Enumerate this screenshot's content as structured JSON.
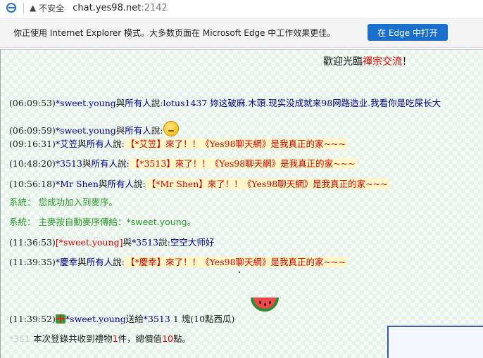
{
  "browser": {
    "security_label": "不安全",
    "url_host": "chat.yes98.net",
    "url_port": ":2142"
  },
  "ie_bar": {
    "message": "你正使用 Internet Explorer 模式。大多数页面在 Microsoft Edge 中工作效果更佳。",
    "button": "在 Edge 中打开"
  },
  "welcome": {
    "prefix": "歡迎光臨",
    "room": "禪宗交流",
    "suffix": "！"
  },
  "messages": [
    {
      "time": "(06:09:53)",
      "from": "*sweet.young",
      "mid": "與",
      "to": "所有人",
      "said": "說:",
      "text": "lotus1437 妳这破麻.木頭.现实没成就来98网路造业.我看你是吃屎长大"
    },
    {
      "time": "(06:09:59)",
      "from": "*sweet.young",
      "mid": "與",
      "to": "所有人",
      "said": "說:",
      "text": ""
    },
    {
      "time": "(09:16:31)",
      "from": "*艾笠",
      "mid": "與",
      "to": "所有人",
      "said": "說:",
      "text": "【*艾笠】來了！！《Yes98聊天網》是我真正的家~~~"
    },
    {
      "time": "(10:48:20)",
      "from": "*3513",
      "mid": "與",
      "to": "所有人",
      "said": "說:",
      "text": "【*3513】來了！！《Yes98聊天網》是我真正的家~~~"
    },
    {
      "time": "(10:56:18)",
      "from": "*Mr Shen",
      "mid": "與",
      "to": "所有人",
      "said": "說:",
      "text": "【*Mr Shen】來了！！《Yes98聊天網》是我真正的家~~~"
    },
    {
      "time": "(11:36:53)",
      "from": "[*sweet.young]",
      "mid": "與",
      "to": "*3513",
      "said": "說:",
      "text": "空空大师好"
    },
    {
      "time": "(11:39:35)",
      "from": "*慶幸",
      "mid": "與",
      "to": "所有人",
      "said": "說:",
      "text": "【*慶幸】來了！！《Yes98聊天網》是我真正的家~~~"
    }
  ],
  "system": [
    {
      "label": "系統：",
      "text": "您成功加入到麥序。"
    },
    {
      "label": "系統：",
      "text": "主麥按自動麥序傳給：",
      "name": "*sweet.young",
      "end": "。"
    }
  ],
  "gift_line": {
    "time": "(11:39:52)",
    "from": "*sweet.young",
    "verb": "送給",
    "to": "*3513",
    "amount": " 1 塊(10點西瓜)"
  },
  "summary": {
    "faded_name": "*351",
    "prefix": " 本次登錄共收到禮物",
    "count": "1",
    "mid": "件，總價值",
    "points": "10",
    "suffix": "點。"
  },
  "icons": [
    "ie-icon",
    "warning-icon",
    "thinking-emoji-icon",
    "gift-icon",
    "watermelon-icon"
  ],
  "colors": {
    "accent_button": "#1a6fcc",
    "name_blue": "#00008b",
    "alert_red": "#d00000",
    "system_green": "#2a9a2a"
  }
}
